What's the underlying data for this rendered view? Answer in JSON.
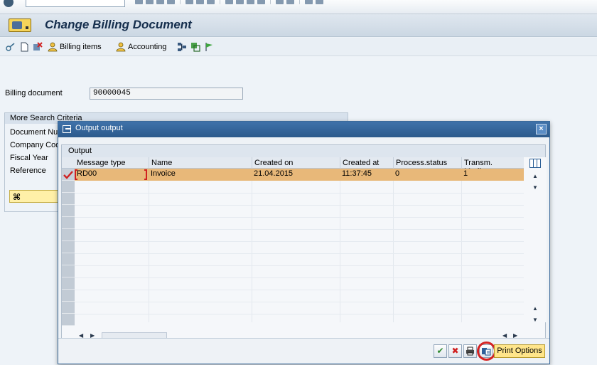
{
  "header": {
    "title": "Change Billing Document"
  },
  "toolbar": {
    "billing_items_label": "Billing items",
    "accounting_label": "Accounting"
  },
  "main": {
    "billing_doc_label": "Billing document",
    "billing_doc_value": "90000045",
    "search_panel": {
      "title": "More Search Criteria",
      "rows": [
        "Document Nu",
        "Company Code",
        "Fiscal Year",
        "Reference"
      ]
    }
  },
  "dialog": {
    "title": "Output output",
    "grid_caption": "Output",
    "columns": [
      "Message type",
      "Name",
      "Created on",
      "Created at",
      "Process.status",
      "Transm. Medium"
    ],
    "rows": [
      {
        "message_type": "RD00",
        "name": "Invoice",
        "created_on": "21.04.2015",
        "created_at": "11:37:45",
        "process_status": "0",
        "transm_medium": "1"
      }
    ],
    "footer": {
      "print_options_label": "Print Options"
    }
  },
  "colors": {
    "selected_row": "#e8b879",
    "title_bar": "#3f72aa",
    "highlight_ring": "#d52222"
  }
}
